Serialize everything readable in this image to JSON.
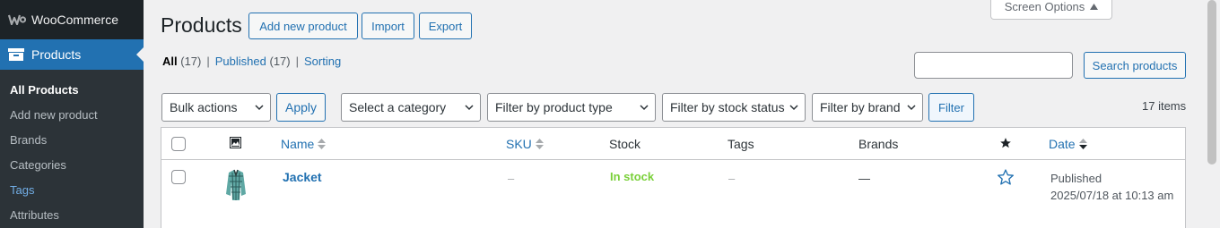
{
  "sidebar": {
    "woocommerce_label": "WooCommerce",
    "products_label": "Products",
    "submenu": [
      "All Products",
      "Add new product",
      "Brands",
      "Categories",
      "Tags",
      "Attributes"
    ]
  },
  "header": {
    "title": "Products",
    "add_new": "Add new product",
    "import": "Import",
    "export": "Export",
    "screen_options": "Screen Options"
  },
  "views": {
    "all": "All",
    "all_count": "(17)",
    "published": "Published",
    "published_count": "(17)",
    "sorting": "Sorting"
  },
  "search": {
    "placeholder": "",
    "button": "Search products"
  },
  "filters": {
    "bulk_actions": "Bulk actions",
    "apply": "Apply",
    "category": "Select a category",
    "product_type": "Filter by product type",
    "stock_status": "Filter by stock status",
    "brand": "Filter by brand",
    "filter_button": "Filter",
    "items_count": "17 items"
  },
  "table": {
    "columns": {
      "name": "Name",
      "sku": "SKU",
      "stock": "Stock",
      "tags": "Tags",
      "brands": "Brands",
      "date": "Date"
    },
    "rows": [
      {
        "name": "Jacket",
        "sku": "–",
        "stock": "In stock",
        "tags": "–",
        "brands": "—",
        "date_status": "Published",
        "date_value": "2025/07/18 at 10:13 am"
      }
    ]
  },
  "colors": {
    "accent": "#2271b1",
    "sidebar": "#1d2327",
    "in_stock": "#7ad03a"
  },
  "icons": [
    "woocommerce-logo-icon",
    "products-icon",
    "image-icon",
    "sort-icon",
    "star-icon",
    "star-outline-icon",
    "chevron-down-icon"
  ]
}
